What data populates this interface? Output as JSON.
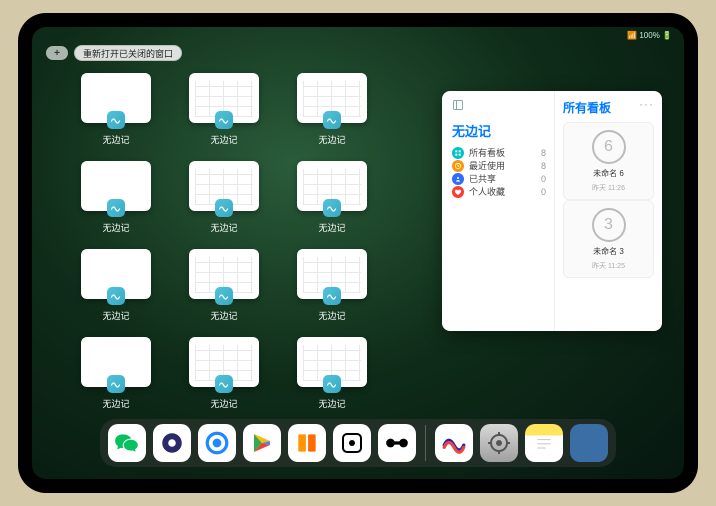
{
  "status": {
    "text": "📶 100% 🔋"
  },
  "topbar": {
    "add_label": "+",
    "reopen_label": "重新打开已关闭的窗口"
  },
  "thumbnails": [
    {
      "label": "无边记",
      "variant": "blank"
    },
    {
      "label": "无边记",
      "variant": "cal"
    },
    {
      "label": "无边记",
      "variant": "cal"
    },
    {
      "label": "无边记",
      "variant": "blank"
    },
    {
      "label": "无边记",
      "variant": "cal"
    },
    {
      "label": "无边记",
      "variant": "cal"
    },
    {
      "label": "无边记",
      "variant": "blank"
    },
    {
      "label": "无边记",
      "variant": "cal"
    },
    {
      "label": "无边记",
      "variant": "cal"
    },
    {
      "label": "无边记",
      "variant": "blank"
    },
    {
      "label": "无边记",
      "variant": "cal"
    },
    {
      "label": "无边记",
      "variant": "cal"
    }
  ],
  "panel": {
    "title": "无边记",
    "right_title": "所有看板",
    "sidebar": [
      {
        "icon": "grid",
        "color": "#00c2c7",
        "label": "所有看板",
        "count": 8
      },
      {
        "icon": "clock",
        "color": "#ff9500",
        "label": "最近使用",
        "count": 8
      },
      {
        "icon": "people",
        "color": "#2f6dff",
        "label": "已共享",
        "count": 0
      },
      {
        "icon": "heart",
        "color": "#ff3b30",
        "label": "个人收藏",
        "count": 0
      }
    ],
    "boards": [
      {
        "sketch": "6",
        "name": "未命名 6",
        "date": "昨天 11:26"
      },
      {
        "sketch": "3",
        "name": "未命名 3",
        "date": "昨天 11:25"
      }
    ],
    "more": "···"
  },
  "dock": [
    {
      "name": "wechat",
      "glyph": "wechat"
    },
    {
      "name": "quark",
      "glyph": "quark"
    },
    {
      "name": "qqbrowser",
      "glyph": "qqb"
    },
    {
      "name": "play",
      "glyph": "play"
    },
    {
      "name": "books",
      "glyph": "books"
    },
    {
      "name": "dice",
      "glyph": "dice"
    },
    {
      "name": "barbell",
      "glyph": "barbell"
    },
    {
      "name": "sep"
    },
    {
      "name": "freeform",
      "glyph": "freeform"
    },
    {
      "name": "settings",
      "glyph": "settings"
    },
    {
      "name": "notes",
      "glyph": "notes"
    },
    {
      "name": "app-folder",
      "glyph": "folder"
    }
  ]
}
